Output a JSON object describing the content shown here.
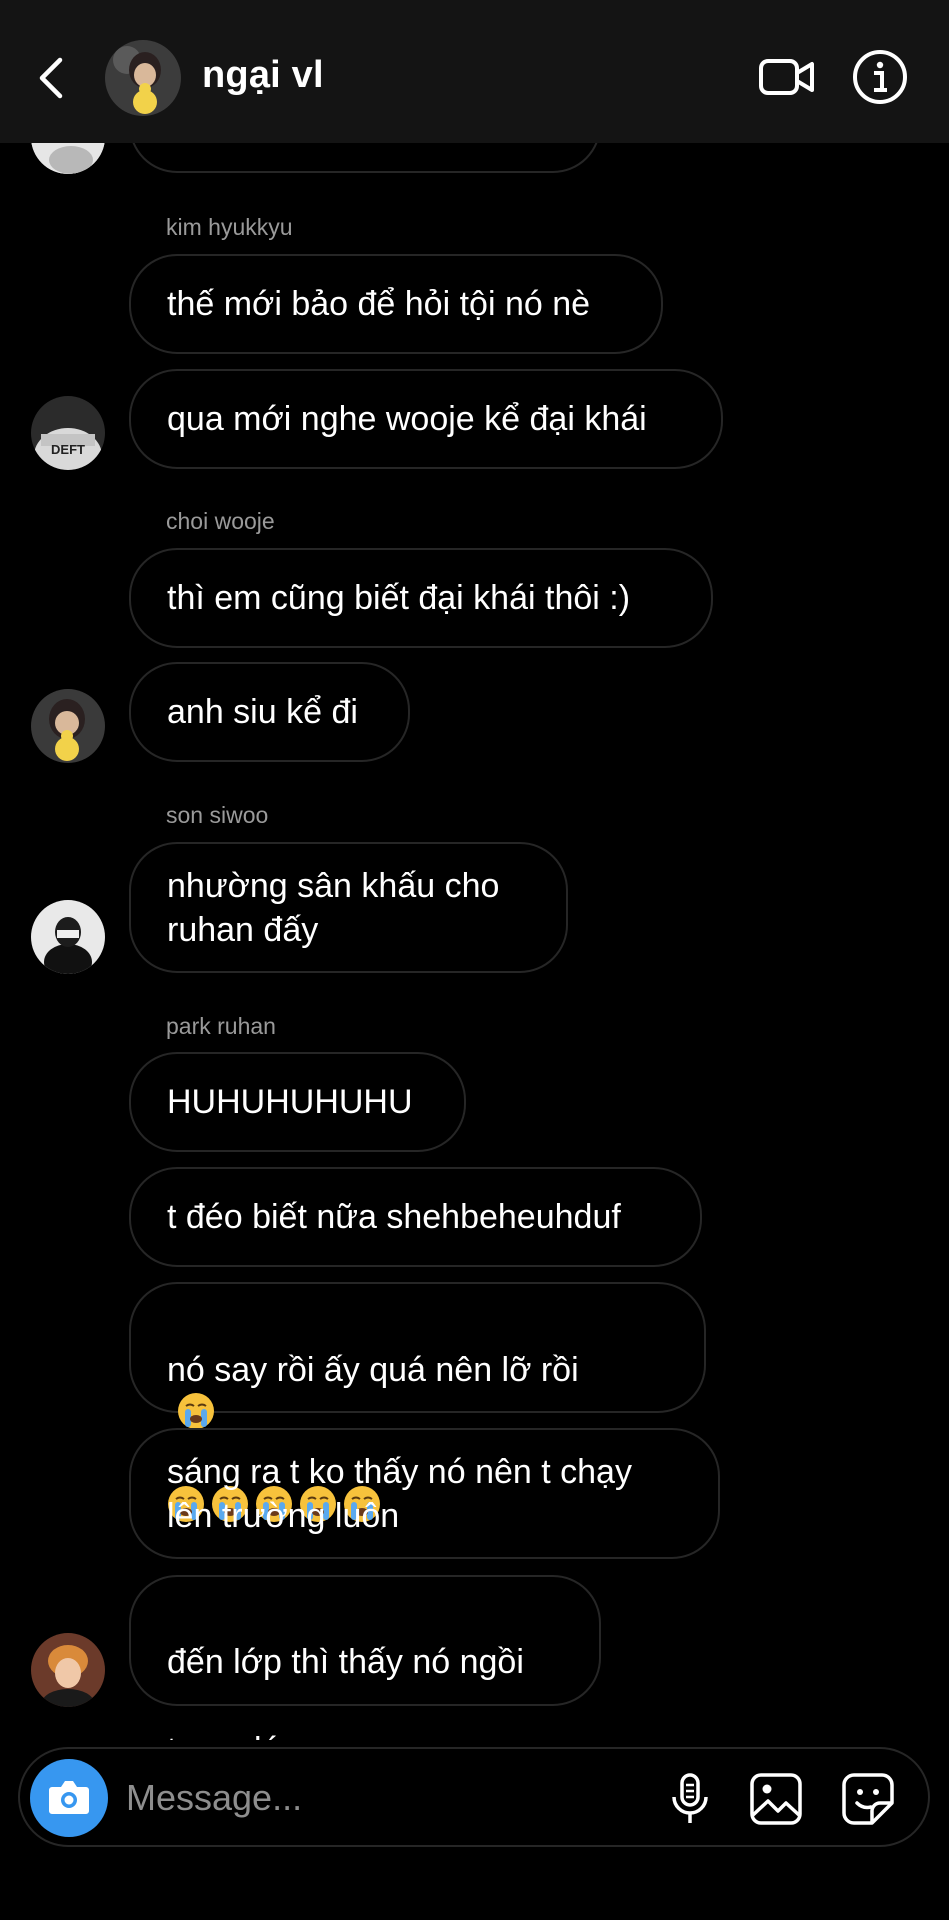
{
  "header": {
    "name": "ngại vl"
  },
  "messages": {
    "m0": "",
    "s1": "kim hyukkyu",
    "m1": "thế mới bảo để hỏi tội nó nè",
    "m2": "qua mới nghe wooje kể đại khái",
    "s2": "choi wooje",
    "m3": "thì em cũng biết đại khái thôi :)",
    "m4": "anh siu kể đi",
    "s3": "son siwoo",
    "m5": "nhường sân khấu cho\nruhan đấy",
    "s4": "park ruhan",
    "m6": "HUHUHUHUHU",
    "m7": "t đéo biết nữa shehbeheuhduf",
    "m8": "nó say rồi ấy quá nên lỡ rồi",
    "m9": "sáng ra t ko thấy nó nên t chạy\nlên trường luôn",
    "m10a": "đến lớp thì thấy nó ngồi",
    "m10b": "trong lớp"
  },
  "avatar_text": {
    "deft": "DEFT"
  },
  "composer": {
    "placeholder": "Message..."
  },
  "colors": {
    "background": "#000000",
    "header": "#141414",
    "bubble_border": "#262626",
    "camera": "#3797f0",
    "sender": "#9a9a9a"
  }
}
